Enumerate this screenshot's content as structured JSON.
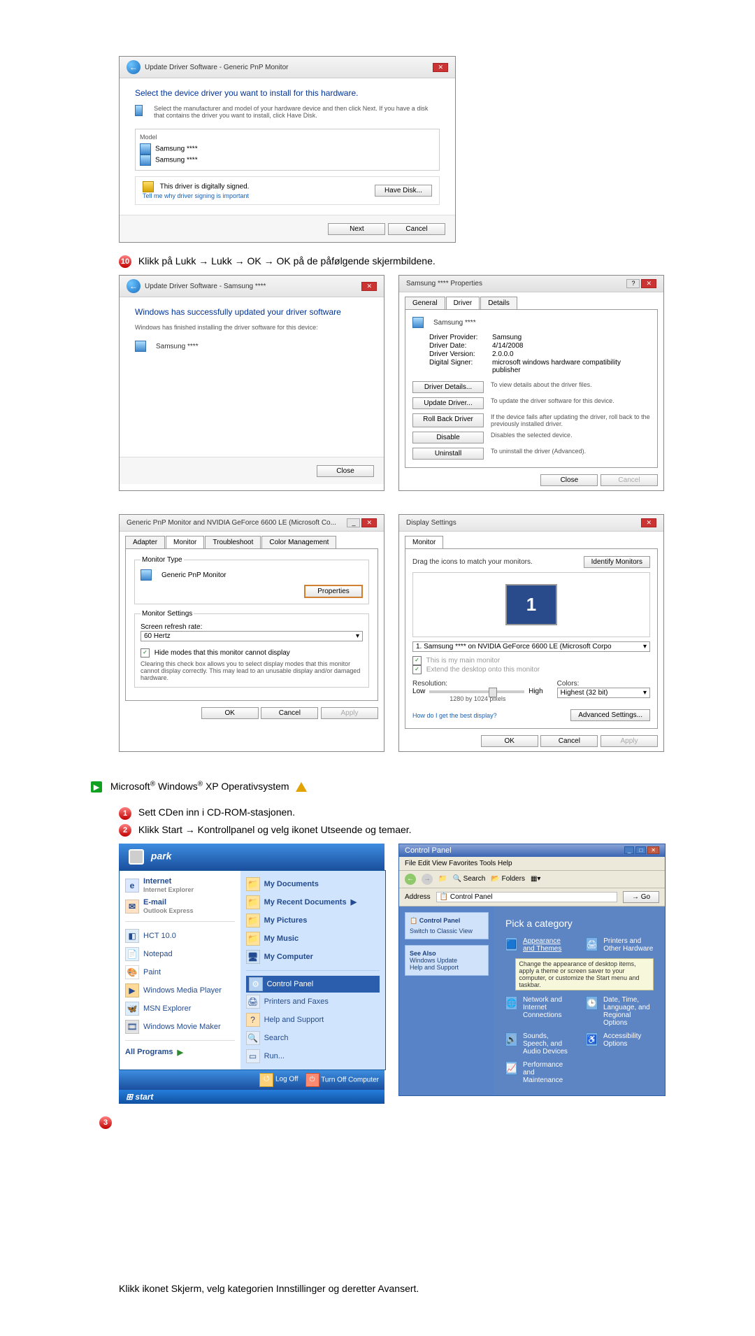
{
  "step10": {
    "label": "Klikk på Lukk → Lukk → OK → OK på de påfølgende skjermbildene."
  },
  "dlg_select": {
    "title": "Update Driver Software - Generic PnP Monitor",
    "heading": "Select the device driver you want to install for this hardware.",
    "subtext": "Select the manufacturer and model of your hardware device and then click Next. If you have a disk that contains the driver you want to install, click Have Disk.",
    "model_label": "Model",
    "model_1": "Samsung ****",
    "model_2": "Samsung ****",
    "signed": "This driver is digitally signed.",
    "tell_me": "Tell me why driver signing is important",
    "have_disk": "Have Disk...",
    "next": "Next",
    "cancel": "Cancel"
  },
  "dlg_success": {
    "title": "Update Driver Software - Samsung ****",
    "line1": "Windows has successfully updated your driver software",
    "line2": "Windows has finished installing the driver software for this device:",
    "device": "Samsung ****",
    "close": "Close"
  },
  "dlg_props": {
    "title": "Samsung **** Properties",
    "tabs": {
      "general": "General",
      "driver": "Driver",
      "details": "Details"
    },
    "device": "Samsung ****",
    "rows": {
      "provider_k": "Driver Provider:",
      "provider_v": "Samsung",
      "date_k": "Driver Date:",
      "date_v": "4/14/2008",
      "version_k": "Driver Version:",
      "version_v": "2.0.0.0",
      "signer_k": "Digital Signer:",
      "signer_v": "microsoft windows hardware compatibility publisher"
    },
    "btn_details": "Driver Details...",
    "btn_details_d": "To view details about the driver files.",
    "btn_update": "Update Driver...",
    "btn_update_d": "To update the driver software for this device.",
    "btn_rollback": "Roll Back Driver",
    "btn_rollback_d": "If the device fails after updating the driver, roll back to the previously installed driver.",
    "btn_disable": "Disable",
    "btn_disable_d": "Disables the selected device.",
    "btn_uninstall": "Uninstall",
    "btn_uninstall_d": "To uninstall the driver (Advanced).",
    "close": "Close",
    "cancel": "Cancel"
  },
  "dlg_monitor": {
    "title": "Generic PnP Monitor and NVIDIA GeForce 6600 LE (Microsoft Co...",
    "tabs": {
      "adapter": "Adapter",
      "monitor": "Monitor",
      "trouble": "Troubleshoot",
      "color": "Color Management"
    },
    "type_leg": "Monitor Type",
    "type_val": "Generic PnP Monitor",
    "properties": "Properties",
    "settings_leg": "Monitor Settings",
    "refresh_lbl": "Screen refresh rate:",
    "refresh_val": "60 Hertz",
    "hide_check": "Hide modes that this monitor cannot display",
    "hide_desc": "Clearing this check box allows you to select display modes that this monitor cannot display correctly. This may lead to an unusable display and/or damaged hardware.",
    "ok": "OK",
    "cancel": "Cancel",
    "apply": "Apply"
  },
  "dlg_display": {
    "title": "Display Settings",
    "tab": "Monitor",
    "drag": "Drag the icons to match your monitors.",
    "identify": "Identify Monitors",
    "device_line": "1. Samsung **** on NVIDIA GeForce 6600 LE (Microsoft Corpo",
    "chk_main": "This is my main monitor",
    "chk_extend": "Extend the desktop onto this monitor",
    "res_lbl": "Resolution:",
    "low": "Low",
    "high": "High",
    "res_val": "1280 by 1024 pixels",
    "colors_lbl": "Colors:",
    "colors_val": "Highest (32 bit)",
    "howto": "How do I get the best display?",
    "advanced": "Advanced Settings...",
    "ok": "OK",
    "cancel": "Cancel",
    "apply": "Apply"
  },
  "xp_heading": "Microsoft® Windows® XP Operativsystem",
  "xp_step1": "Sett CDen inn i CD-ROM-stasjonen.",
  "xp_step2": "Klikk Start → Kontrollpanel og velg ikonet Utseende og temaer.",
  "start": {
    "user": "park",
    "left": {
      "internet": "Internet",
      "internet_sub": "Internet Explorer",
      "email": "E-mail",
      "email_sub": "Outlook Express",
      "hct": "HCT 10.0",
      "notepad": "Notepad",
      "paint": "Paint",
      "wmp": "Windows Media Player",
      "msn": "MSN Explorer",
      "wmm": "Windows Movie Maker",
      "allprog": "All Programs"
    },
    "right": {
      "mydocs": "My Documents",
      "recent": "My Recent Documents",
      "mypics": "My Pictures",
      "mymusic": "My Music",
      "mycomp": "My Computer",
      "cpanel": "Control Panel",
      "printers": "Printers and Faxes",
      "help": "Help and Support",
      "search": "Search",
      "run": "Run..."
    },
    "logoff": "Log Off",
    "turnoff": "Turn Off Computer",
    "start": "start"
  },
  "cp": {
    "title": "Control Panel",
    "menu": "File  Edit  View  Favorites  Tools  Help",
    "address": "Control Panel",
    "side_h": "Control Panel",
    "side_switch": "Switch to Classic View",
    "see_also": "See Also",
    "see1": "Windows Update",
    "see2": "Help and Support",
    "pick": "Pick a category",
    "cats": {
      "c1": "Appearance and Themes",
      "c2": "Printers and Other Hardware",
      "c3": "Change the appearance of desktop items, apply a theme or screen saver to your computer, or customize the Start menu and taskbar.",
      "c4": "Network and Internet Connections",
      "c5": "Date, Time, Language, and Regional Options",
      "c6": "Sounds, Speech, and Audio Devices",
      "c7": "Accessibility Options",
      "c8": "Performance and Maintenance"
    }
  },
  "bottom_text": "Klikk ikonet Skjerm, velg kategorien Innstillinger og deretter Avansert."
}
